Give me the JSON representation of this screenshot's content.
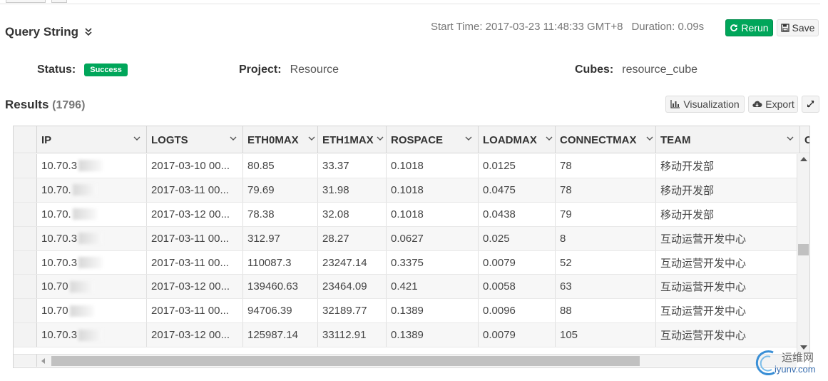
{
  "query": {
    "title": "Query String",
    "start_time": "Start Time: 2017-03-23 11:48:33 GMT+8",
    "duration": "Duration: 0.09s",
    "rerun_label": "Rerun",
    "save_label": "Save"
  },
  "info": {
    "status_label": "Status:",
    "status_value": "Success",
    "project_label": "Project:",
    "project_value": "Resource",
    "cubes_label": "Cubes:",
    "cubes_value": "resource_cube"
  },
  "results": {
    "title": "Results",
    "count": "(1796)",
    "visualization_label": "Visualization",
    "export_label": "Export"
  },
  "table": {
    "columns": [
      "IP",
      "LOGTS",
      "ETH0MAX",
      "ETH1MAX",
      "ROSPACE",
      "LOADMAX",
      "CONNECTMAX",
      "TEAM",
      "COU"
    ],
    "rows": [
      [
        "10.70.3",
        "2017-03-10 00...",
        "80.85",
        "33.37",
        "0.1018",
        "0.0125",
        "78",
        "移动开发部"
      ],
      [
        "10.70.",
        "2017-03-11 00...",
        "79.69",
        "31.98",
        "0.1018",
        "0.0475",
        "78",
        "移动开发部"
      ],
      [
        "10.70.",
        "2017-03-12 00...",
        "78.38",
        "32.08",
        "0.1018",
        "0.0438",
        "79",
        "移动开发部"
      ],
      [
        "10.70.3",
        "2017-03-11 00...",
        "312.97",
        "28.27",
        "0.0627",
        "0.025",
        "8",
        "互动运营开发中心"
      ],
      [
        "10.70.3",
        "2017-03-11 00...",
        "110087.3",
        "23247.14",
        "0.3375",
        "0.0079",
        "52",
        "互动运营开发中心"
      ],
      [
        "10.70",
        "2017-03-12 00...",
        "139460.63",
        "23464.09",
        "0.421",
        "0.0058",
        "63",
        "互动运营开发中心"
      ],
      [
        "10.70",
        "2017-03-11 00...",
        "94706.39",
        "32189.77",
        "0.1389",
        "0.0096",
        "88",
        "互动运营开发中心"
      ],
      [
        "10.70.3",
        "2017-03-12 00...",
        "125987.14",
        "33112.91",
        "0.1389",
        "0.0079",
        "105",
        "互动运营开发中心"
      ]
    ]
  },
  "watermark": {
    "line1": "运维网",
    "line2": "iyunv.com"
  },
  "colors": {
    "success": "#00a65a",
    "header_bg": "#f3f3f3"
  }
}
